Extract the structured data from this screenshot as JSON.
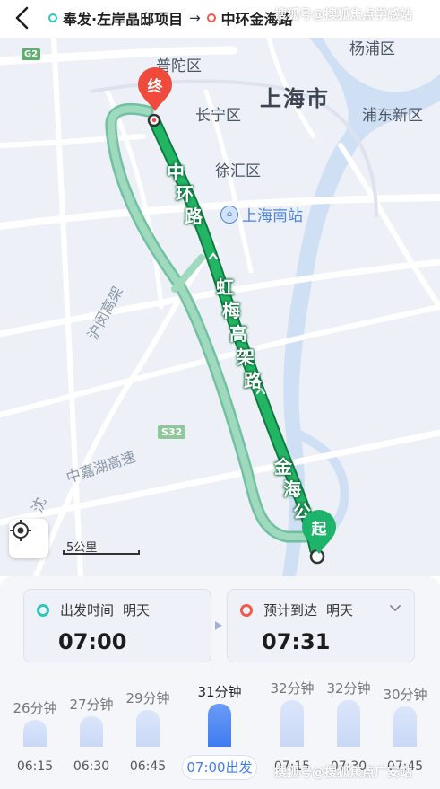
{
  "header": {
    "origin": "奉发·左岸晶邸项目",
    "arrow": "→",
    "destination": "中环金海路"
  },
  "map": {
    "districts": [
      "普陀区",
      "长宁区",
      "徐汇区",
      "浦东新区",
      "杨浦区"
    ],
    "city": "上海市",
    "station": "上海南站",
    "roads": {
      "huming": "沪闵高架",
      "jiashan": "中嘉湖高速",
      "shen": "沈"
    },
    "route_labels": {
      "zhonghuan": [
        "中",
        "环",
        "路"
      ],
      "hongmei": [
        "虹",
        "梅",
        "高",
        "架",
        "路"
      ],
      "jinhai": [
        "金",
        "海",
        "公"
      ]
    },
    "badges": {
      "g2": "G2",
      "s32": "S32"
    },
    "markers": {
      "end": "终",
      "start": "起"
    },
    "scale": "5公里",
    "icons": {
      "locate": "crosshair-icon",
      "back": "chevron-left-icon"
    },
    "colors": {
      "route": "#1aa05a",
      "alt_route": "#8fd0b1",
      "end_marker": "#ef4a3b",
      "start_marker": "#1db36a",
      "water": "#cfe0f4"
    }
  },
  "watermarks": [
    "搜狐号@搜狐焦点学感站",
    "搜狐号@搜狐焦点广安站"
  ],
  "depart": {
    "label": "出发时间",
    "day": "明天",
    "time": "07:00",
    "dot_color": "#2ec7c0"
  },
  "arrive": {
    "label": "预计到达",
    "day": "明天",
    "time": "07:31",
    "dot_color": "#f25a4a"
  },
  "time_options": [
    {
      "duration": "26分钟",
      "time": "06:15",
      "selected": false
    },
    {
      "duration": "27分钟",
      "time": "06:30",
      "selected": false
    },
    {
      "duration": "29分钟",
      "time": "06:45",
      "selected": false
    },
    {
      "duration": "31分钟",
      "time": "07:00出发",
      "selected": true
    },
    {
      "duration": "32分钟",
      "time": "07:15",
      "selected": false
    },
    {
      "duration": "32分钟",
      "time": "07:30",
      "selected": false
    },
    {
      "duration": "30分钟",
      "time": "07:45",
      "selected": false
    }
  ]
}
